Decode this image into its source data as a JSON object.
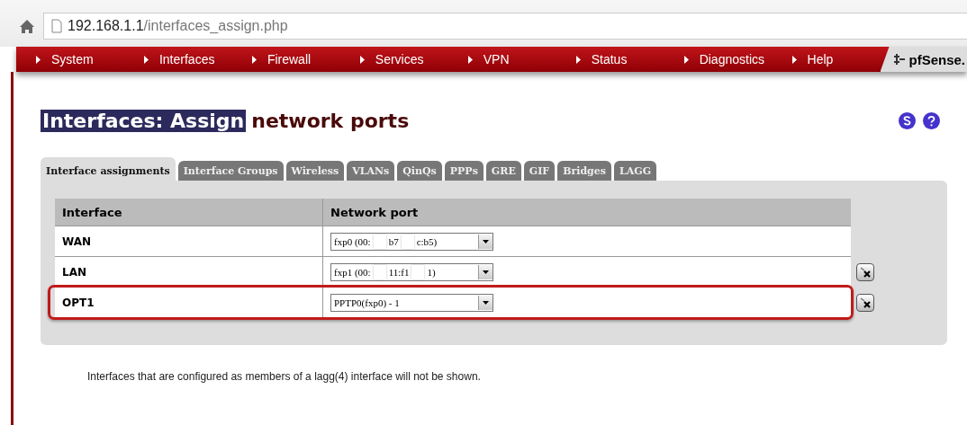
{
  "address_bar": {
    "host": "192.168.1.1",
    "path": "/interfaces_assign.php"
  },
  "nav": {
    "items": [
      "System",
      "Interfaces",
      "Firewall",
      "Services",
      "VPN",
      "Status",
      "Diagnostics",
      "Help"
    ],
    "logo": "pfSense."
  },
  "title": {
    "highlighted": "Interfaces: Assign",
    "rest": "network ports"
  },
  "tabs": [
    {
      "label": "Interface assignments",
      "selected": true
    },
    {
      "label": "Interface Groups",
      "selected": false
    },
    {
      "label": "Wireless",
      "selected": false
    },
    {
      "label": "VLANs",
      "selected": false
    },
    {
      "label": "QinQs",
      "selected": false
    },
    {
      "label": "PPPs",
      "selected": false
    },
    {
      "label": "GRE",
      "selected": false
    },
    {
      "label": "GIF",
      "selected": false
    },
    {
      "label": "Bridges",
      "selected": false
    },
    {
      "label": "LAGG",
      "selected": false
    }
  ],
  "table": {
    "columns": [
      "Interface",
      "Network port"
    ],
    "rows": [
      {
        "interface": "WAN",
        "port_parts": [
          "fxp0 (00:",
          "b7",
          "c:b5)"
        ],
        "deletable": false,
        "highlighted": false
      },
      {
        "interface": "LAN",
        "port_parts": [
          "fxp1 (00:",
          "11:f1",
          "1)"
        ],
        "deletable": true,
        "highlighted": false
      },
      {
        "interface": "OPT1",
        "port_parts": [
          "PPTP0(fxp0) - 1"
        ],
        "deletable": true,
        "highlighted": true
      }
    ]
  },
  "note": "Interfaces that are configured as members of a lagg(4) interface will not be shown."
}
